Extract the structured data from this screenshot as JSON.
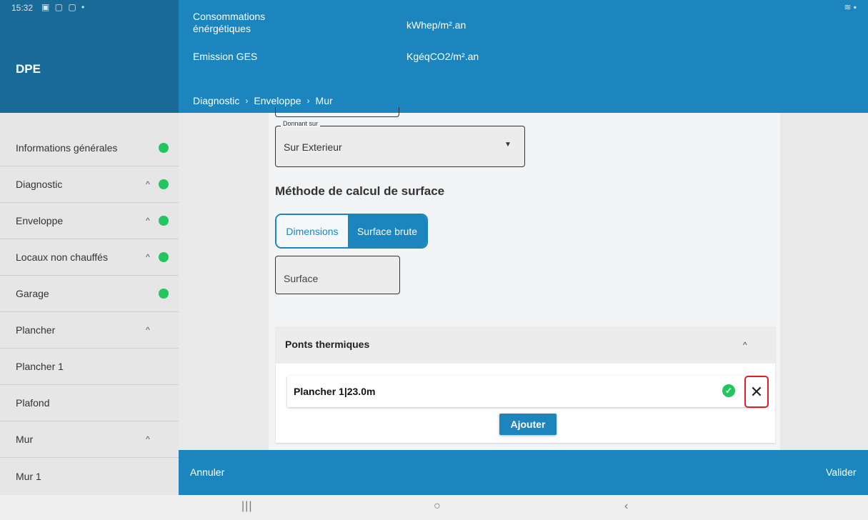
{
  "status_bar": {
    "time": "15:32",
    "left_icons": "▣ ▢ ▢ •",
    "right_icons": "≋ ▪"
  },
  "app": {
    "title": "DPE"
  },
  "header": {
    "label_1": "Consommations énérgétiques",
    "unit_1": "kWhep/m².an",
    "label_2": "Emission GES",
    "unit_2": "KgéqCO2/m².an",
    "breadcrumb": [
      "Diagnostic",
      "Enveloppe",
      "Mur"
    ],
    "breadcrumb_sep": "›"
  },
  "sidebar": {
    "items": [
      {
        "label": "Informations générales",
        "chevron": "",
        "dot": true
      },
      {
        "label": "Diagnostic",
        "chevron": "^",
        "dot": true
      },
      {
        "label": "Enveloppe",
        "chevron": "^",
        "dot": true
      },
      {
        "label": "Locaux non chauffés",
        "chevron": "^",
        "dot": true
      },
      {
        "label": "Garage",
        "chevron": "",
        "dot": true
      },
      {
        "label": "Plancher",
        "chevron": "^",
        "dot": false
      },
      {
        "label": "Plancher 1",
        "chevron": "",
        "dot": false
      },
      {
        "label": "Plafond",
        "chevron": "",
        "dot": false
      },
      {
        "label": "Mur",
        "chevron": "^",
        "dot": false
      },
      {
        "label": "Mur 1",
        "chevron": "",
        "dot": false
      }
    ]
  },
  "form": {
    "donnant_sur": {
      "legend": "Donnant sur",
      "value": "Sur Exterieur",
      "arrow": "▼"
    },
    "method_title": "Méthode de calcul de surface",
    "toggle": {
      "option_1": "Dimensions",
      "option_2": "Surface brute",
      "selected": "Surface brute"
    },
    "surface": {
      "label": "Surface"
    }
  },
  "ponts_thermiques": {
    "title": "Ponts thermiques",
    "chevron": "^",
    "rows": [
      {
        "label": "Plancher 1|23.0m",
        "check": "✓",
        "remove": "✕"
      }
    ],
    "add_label": "Ajouter"
  },
  "footer": {
    "cancel": "Annuler",
    "validate": "Valider"
  },
  "nav": {
    "recents": "|||",
    "home": "○",
    "back": "‹"
  },
  "colors": {
    "primary": "#1c85bd",
    "primary_dark": "#1a6a98",
    "success": "#22c55e",
    "highlight": "#e11d2a"
  }
}
